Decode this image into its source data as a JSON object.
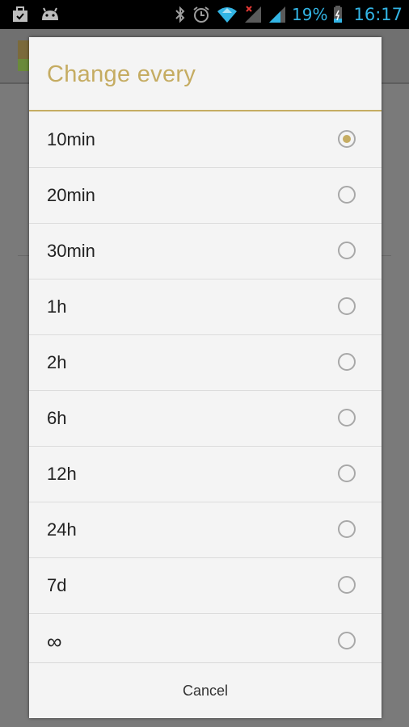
{
  "status_bar": {
    "battery": "19%",
    "time": "16:17",
    "accent_color": "#33b5e5",
    "icons": [
      "briefcase-icon",
      "android-icon",
      "bluetooth-icon",
      "alarm-icon",
      "wifi-icon",
      "signal-icon",
      "signal-icon",
      "battery-icon"
    ]
  },
  "dialog": {
    "title": "Change every",
    "accent_color": "#c5ac62",
    "options": [
      {
        "label": "10min",
        "selected": true
      },
      {
        "label": "20min",
        "selected": false
      },
      {
        "label": "30min",
        "selected": false
      },
      {
        "label": "1h",
        "selected": false
      },
      {
        "label": "2h",
        "selected": false
      },
      {
        "label": "6h",
        "selected": false
      },
      {
        "label": "12h",
        "selected": false
      },
      {
        "label": "24h",
        "selected": false
      },
      {
        "label": "7d",
        "selected": false
      },
      {
        "label": "∞",
        "selected": false
      }
    ],
    "cancel_label": "Cancel"
  }
}
